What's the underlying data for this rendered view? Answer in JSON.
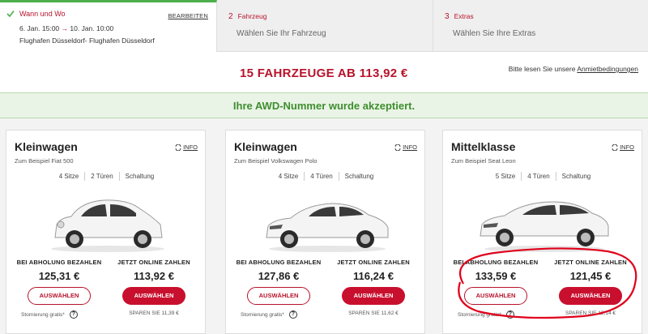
{
  "steps": [
    {
      "title": "Wann und Wo",
      "edit": "BEARBEITEN",
      "dates_from": "6. Jan. 15:00",
      "arrow": "→",
      "dates_to": "10. Jan. 10:00",
      "location": "Flughafen Düsseldorf- Flughafen Düsseldorf"
    },
    {
      "num": "2",
      "title": "Fahrzeug",
      "sub": "Wählen Sie Ihr Fahrzeug"
    },
    {
      "num": "3",
      "title": "Extras",
      "sub": "Wählen Sie Ihre Extras"
    }
  ],
  "headline": {
    "title": "15 FAHRZEUGE AB 113,92 €",
    "terms_prefix": "Bitte lesen Sie unsere ",
    "terms_link": "Anmietbedingungen"
  },
  "banner": "Ihre AWD-Nummer wurde akzeptiert.",
  "cards": [
    {
      "name": "Kleinwagen",
      "example": "Zum Beispiel Fiat 500",
      "info": "INFO",
      "features": [
        "4 Sitze",
        "2 Türen",
        "Schaltung"
      ],
      "pay_later_label": "BEI ABHOLUNG BEZAHLEN",
      "pay_later_price": "125,31 €",
      "pay_now_label": "JETZT ONLINE ZAHLEN",
      "pay_now_price": "113,92 €",
      "select_label": "AUSWÄHLEN",
      "storno": "Stornierung gratis*",
      "save": "SPAREN SIE 11,39 €"
    },
    {
      "name": "Kleinwagen",
      "example": "Zum Beispiel Volkswagen Polo",
      "info": "INFO",
      "features": [
        "4 Sitze",
        "4 Türen",
        "Schaltung"
      ],
      "pay_later_label": "BEI ABHOLUNG BEZAHLEN",
      "pay_later_price": "127,86 €",
      "pay_now_label": "JETZT ONLINE ZAHLEN",
      "pay_now_price": "116,24 €",
      "select_label": "AUSWÄHLEN",
      "storno": "Stornierung gratis*",
      "save": "SPAREN SIE 11,62 €"
    },
    {
      "name": "Mittelklasse",
      "example": "Zum Beispiel Seat Leon",
      "info": "INFO",
      "features": [
        "5 Sitze",
        "4 Türen",
        "Schaltung"
      ],
      "pay_later_label": "BEI ABHOLUNG BEZAHLEN",
      "pay_later_price": "133,59 €",
      "pay_now_label": "JETZT ONLINE ZAHLEN",
      "pay_now_price": "121,45 €",
      "select_label": "AUSWÄHLEN",
      "storno": "Stornierung gratis*",
      "save": "SPAREN SIE 12,14 €"
    }
  ],
  "colors": {
    "accent": "#c8102e",
    "success": "#3e8e2f",
    "annotation": "#e0001b"
  }
}
